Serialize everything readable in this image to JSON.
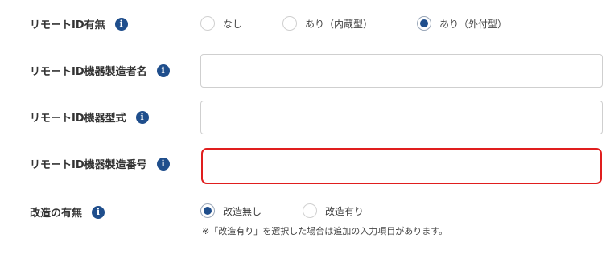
{
  "fields": {
    "remote_id": {
      "label": "リモートID有無",
      "options": [
        "なし",
        "あり（内蔵型）",
        "あり（外付型）"
      ],
      "selected": "あり（外付型）"
    },
    "manufacturer": {
      "label": "リモートID機器製造者名",
      "value": ""
    },
    "model": {
      "label": "リモートID機器型式",
      "value": ""
    },
    "serial": {
      "label": "リモートID機器製造番号",
      "value": "",
      "state": "error"
    },
    "modification": {
      "label": "改造の有無",
      "options": [
        "改造無し",
        "改造有り"
      ],
      "selected": "改造無し",
      "note": "※「改造有り」を選択した場合は追加の入力項目があります。"
    }
  },
  "info_icon": {
    "glyph": "i",
    "name": "info-icon"
  },
  "colors": {
    "accent": "#1f4e8c",
    "error": "#e01e1e",
    "border": "#cfcfcf"
  }
}
